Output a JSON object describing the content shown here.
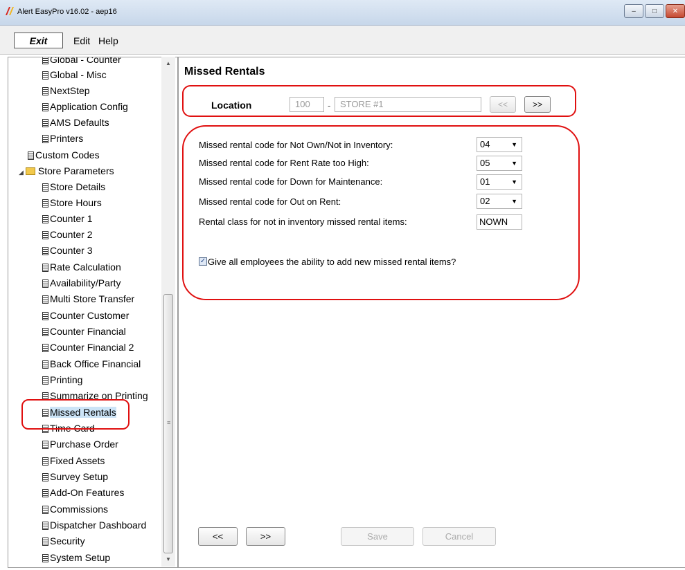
{
  "window": {
    "title": "Alert EasyPro v16.02 - aep16",
    "minimize_glyph": "–",
    "maximize_glyph": "□",
    "close_glyph": "✕"
  },
  "menu": {
    "exit": "Exit",
    "edit": "Edit",
    "help": "Help"
  },
  "tree": {
    "items": [
      {
        "label": "Global - Counter"
      },
      {
        "label": "Global - Misc"
      },
      {
        "label": "NextStep"
      },
      {
        "label": "Application Config"
      },
      {
        "label": "AMS Defaults"
      },
      {
        "label": "Printers"
      },
      {
        "label": "Custom Codes"
      },
      {
        "label": "Store Parameters"
      },
      {
        "label": "Store Details"
      },
      {
        "label": "Store Hours"
      },
      {
        "label": "Counter 1"
      },
      {
        "label": "Counter 2"
      },
      {
        "label": "Counter 3"
      },
      {
        "label": "Rate Calculation"
      },
      {
        "label": "Availability/Party"
      },
      {
        "label": "Multi Store Transfer"
      },
      {
        "label": "Counter Customer"
      },
      {
        "label": "Counter Financial"
      },
      {
        "label": "Counter Financial 2"
      },
      {
        "label": "Back Office Financial"
      },
      {
        "label": "Printing"
      },
      {
        "label": "Summarize on Printing"
      },
      {
        "label": "Missed Rentals"
      },
      {
        "label": "Time Card"
      },
      {
        "label": "Purchase Order"
      },
      {
        "label": "Fixed Assets"
      },
      {
        "label": "Survey Setup"
      },
      {
        "label": "Add-On Features"
      },
      {
        "label": "Commissions"
      },
      {
        "label": "Dispatcher Dashboard"
      },
      {
        "label": "Security"
      },
      {
        "label": "System Setup"
      }
    ],
    "selected": "Missed Rentals"
  },
  "main": {
    "title": "Missed Rentals",
    "location": {
      "label": "Location",
      "code": "100",
      "separator": "-",
      "name": "STORE #1",
      "prev_label": "<<",
      "next_label": ">>"
    },
    "settings": [
      {
        "label": "Missed rental code for Not Own/Not in Inventory:",
        "value": "04"
      },
      {
        "label": "Missed rental code for Rent Rate too High:",
        "value": "05"
      },
      {
        "label": "Missed rental code for Down for Maintenance:",
        "value": "01"
      },
      {
        "label": "Missed rental code for Out on Rent:",
        "value": "02"
      }
    ],
    "rental_class": {
      "label": "Rental class for not in inventory missed rental items:",
      "value": "NOWN"
    },
    "checkbox": {
      "label": "Give all employees the ability to add new missed rental items?",
      "checked": true
    },
    "footer": {
      "prev_label": "<<",
      "next_label": ">>",
      "save_label": "Save",
      "cancel_label": "Cancel"
    }
  },
  "colors": {
    "highlight": "#e01010",
    "selected_bg": "#cce4f7"
  }
}
